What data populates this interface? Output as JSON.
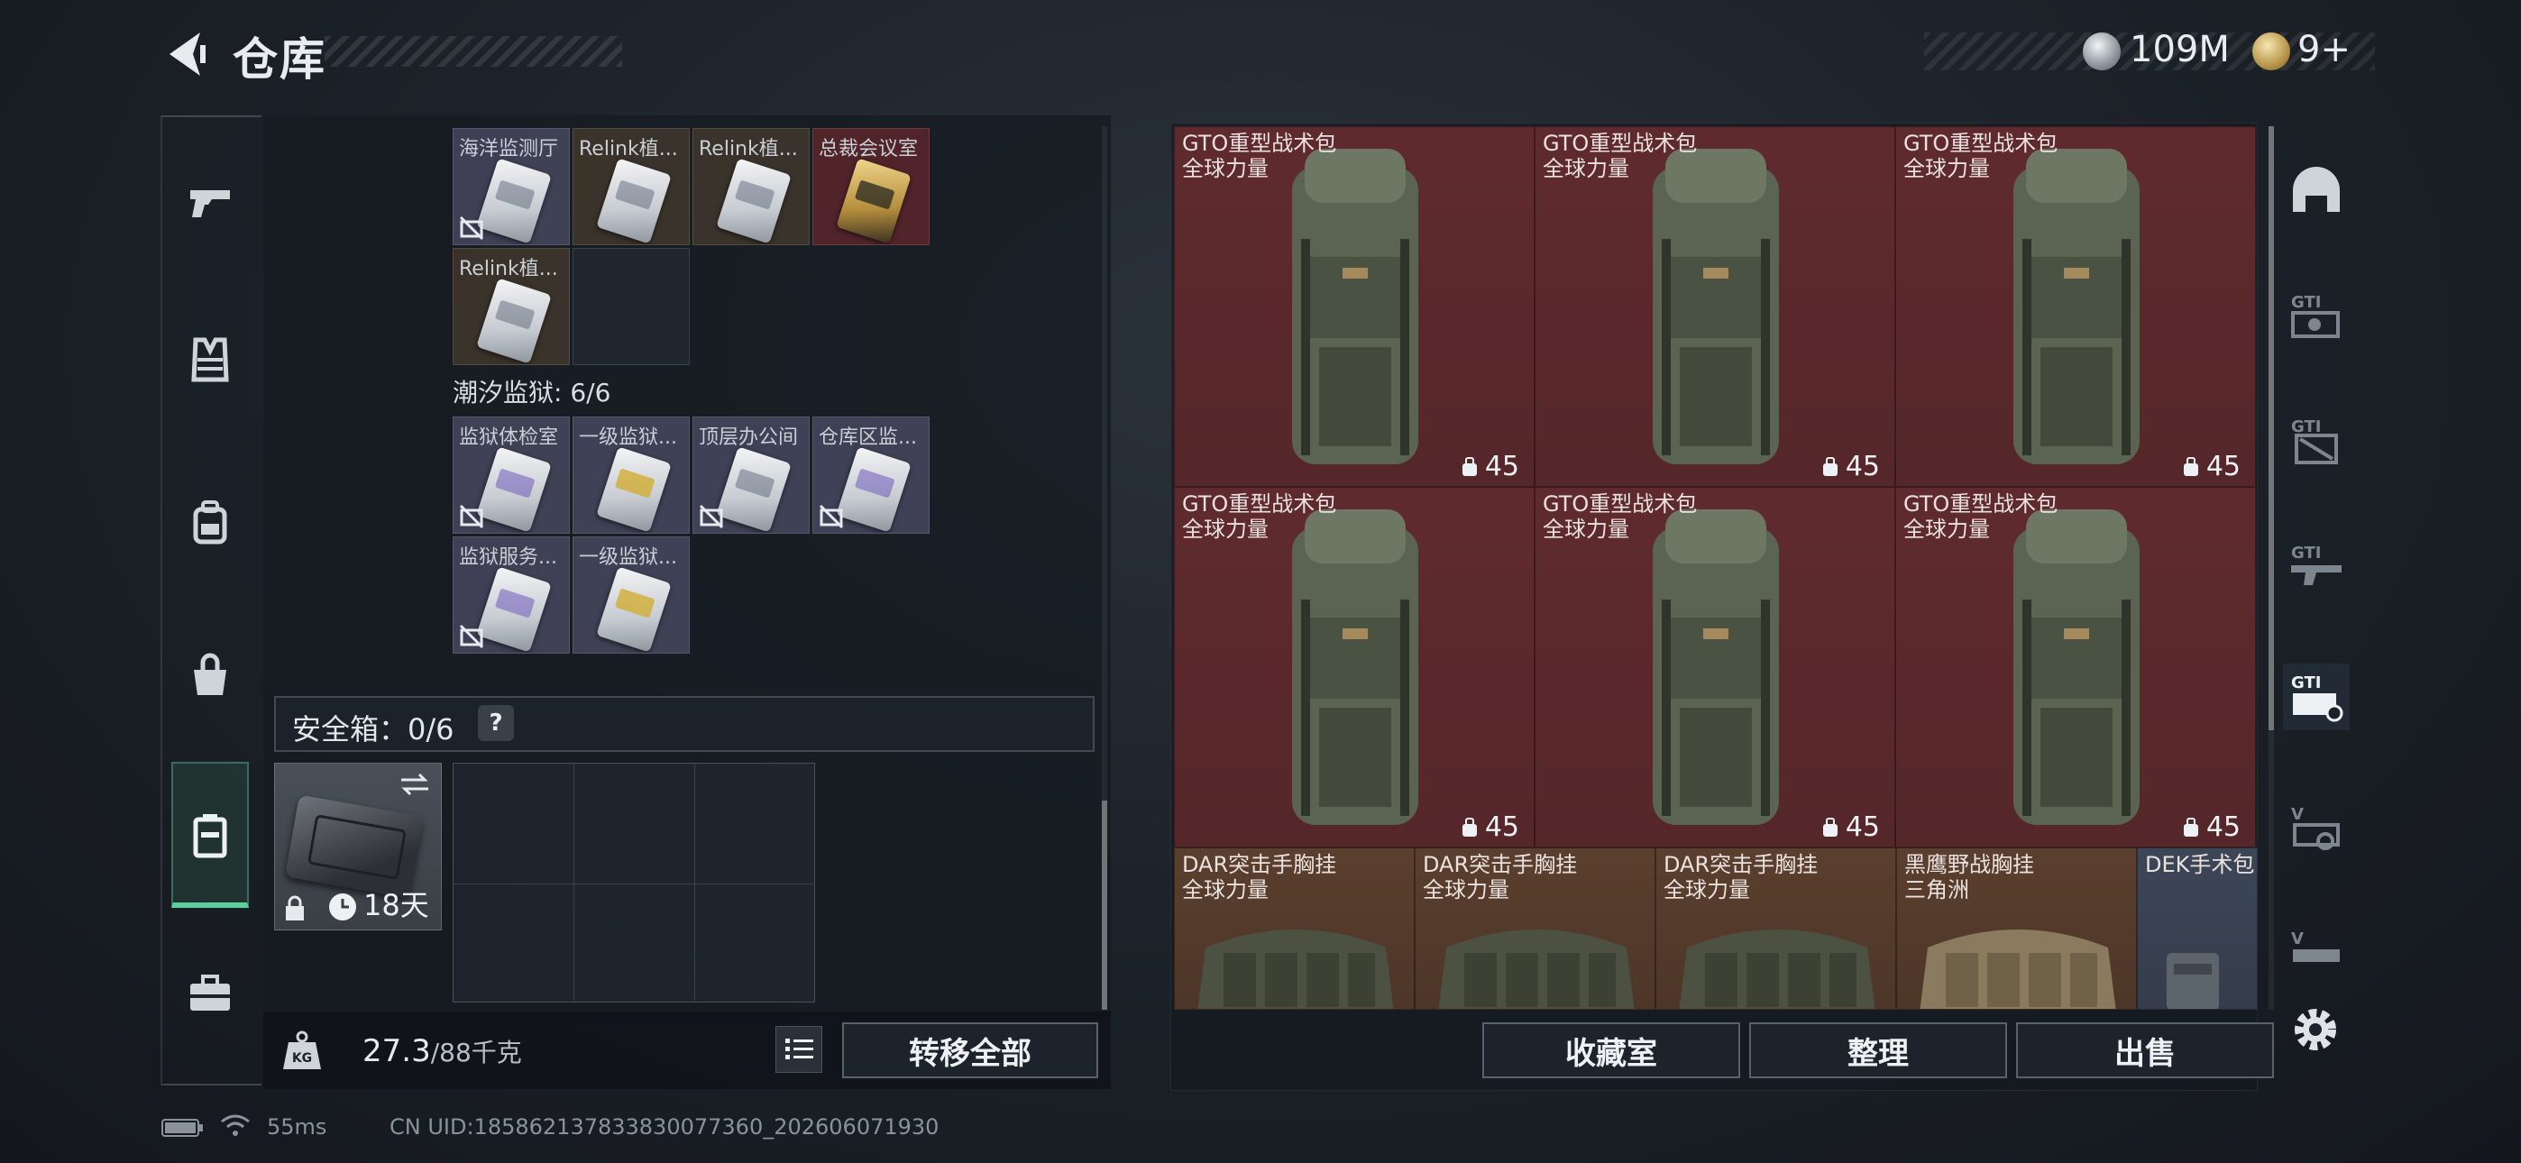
{
  "header": {
    "title": "仓库",
    "currency_silver": "109M",
    "currency_gold": "9+"
  },
  "left_nav": {
    "items": [
      "pistol-icon",
      "armor-vest-icon",
      "backpack-icon",
      "bag-icon",
      "safebox-icon",
      "toolbox-icon"
    ],
    "active": "safebox-icon"
  },
  "keys_grid_top": [
    {
      "label": "海洋监测厅",
      "bg": "purple",
      "card": "silver",
      "no_photo": true
    },
    {
      "label": "Relink植...",
      "bg": "brown",
      "card": "silver",
      "no_photo": false
    },
    {
      "label": "Relink植...",
      "bg": "brown",
      "card": "silver",
      "no_photo": false
    },
    {
      "label": "总裁会议室",
      "bg": "red",
      "card": "gold",
      "no_photo": false
    },
    {
      "label": "Relink植...",
      "bg": "brown",
      "card": "silver",
      "no_photo": false
    }
  ],
  "prison_section": {
    "title": "潮汐监狱: 6/6",
    "keys": [
      {
        "label": "监狱体检室",
        "card": "purple",
        "no_photo": true
      },
      {
        "label": "一级监狱...",
        "card": "yellow",
        "no_photo": false
      },
      {
        "label": "顶层办公间",
        "card": "silver",
        "no_photo": true
      },
      {
        "label": "仓库区监...",
        "card": "purple",
        "no_photo": true
      },
      {
        "label": "监狱服务...",
        "card": "purple",
        "no_photo": true
      },
      {
        "label": "一级监狱...",
        "card": "yellow",
        "no_photo": false
      }
    ]
  },
  "safebox": {
    "label": "安全箱：0/6",
    "help": "?",
    "duration": "18天"
  },
  "weight": {
    "current": "27.3",
    "max_unit": "/88千克"
  },
  "buttons": {
    "transfer_all": "转移全部",
    "collection": "收藏室",
    "organize": "整理",
    "sell": "出售"
  },
  "right_grid": {
    "backpacks": [
      {
        "name": "GTO重型战术包",
        "tag": "全球力量",
        "count": "45"
      },
      {
        "name": "GTO重型战术包",
        "tag": "全球力量",
        "count": "45"
      },
      {
        "name": "GTO重型战术包",
        "tag": "全球力量",
        "count": "45"
      },
      {
        "name": "GTO重型战术包",
        "tag": "全球力量",
        "count": "45"
      },
      {
        "name": "GTO重型战术包",
        "tag": "全球力量",
        "count": "45"
      },
      {
        "name": "GTO重型战术包",
        "tag": "全球力量",
        "count": "45"
      }
    ],
    "vests": [
      {
        "name": "DAR突击手胸挂",
        "tag": "全球力量",
        "color": "#5b3f2e"
      },
      {
        "name": "DAR突击手胸挂",
        "tag": "全球力量",
        "color": "#5b3f2e"
      },
      {
        "name": "DAR突击手胸挂",
        "tag": "全球力量",
        "color": "#5b3f2e"
      },
      {
        "name": "黑鹰野战胸挂",
        "tag": "三角洲",
        "color": "#5b3f2e"
      },
      {
        "name": "DEK手术包",
        "tag": "",
        "color": "#3d4657"
      }
    ]
  },
  "right_tabs": [
    "helmet-icon",
    "gti-camera-icon",
    "gti-box-icon",
    "gti-gun-icon",
    "gti-case-icon",
    "v-tool-icon",
    "v-vehicle-icon"
  ],
  "status_bar": {
    "ping": "55ms",
    "uid": "CN UID:18586213783383007736​0_202606071930"
  }
}
